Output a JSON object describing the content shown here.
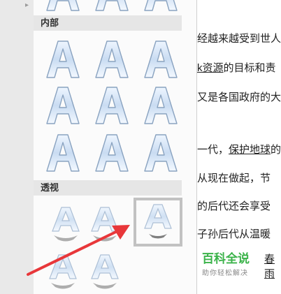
{
  "gallery": {
    "sections": [
      {
        "label": "内部"
      },
      {
        "label": "透视"
      }
    ],
    "glyph": "A"
  },
  "document": {
    "lines": [
      {
        "segments": [
          {
            "text": "经越来越受到世人",
            "link": false
          }
        ]
      },
      {
        "segments": [
          {
            "text": "k资源",
            "link": true
          },
          {
            "text": "的目标和责",
            "link": false
          }
        ]
      },
      {
        "segments": [
          {
            "text": "又是各国政府的大",
            "link": false
          }
        ]
      },
      {
        "segments": [
          {
            "text": "一代，",
            "link": false
          },
          {
            "text": "保护地球",
            "link": true
          },
          {
            "text": "的",
            "link": false
          }
        ]
      },
      {
        "segments": [
          {
            "text": "从现在做起，节",
            "link": false
          }
        ]
      },
      {
        "segments": [
          {
            "text": "的后代还会享受",
            "link": false
          }
        ]
      },
      {
        "segments": [
          {
            "text": "子孙后代从温暖",
            "link": false
          }
        ]
      }
    ]
  },
  "watermark": {
    "title": "百科全说",
    "subtitle": "助你轻松解决",
    "tail": "春雨"
  },
  "colors": {
    "accent_green": "#3bb34a",
    "arrow_red": "#e8373a",
    "header_bg": "#e6e6e6"
  }
}
